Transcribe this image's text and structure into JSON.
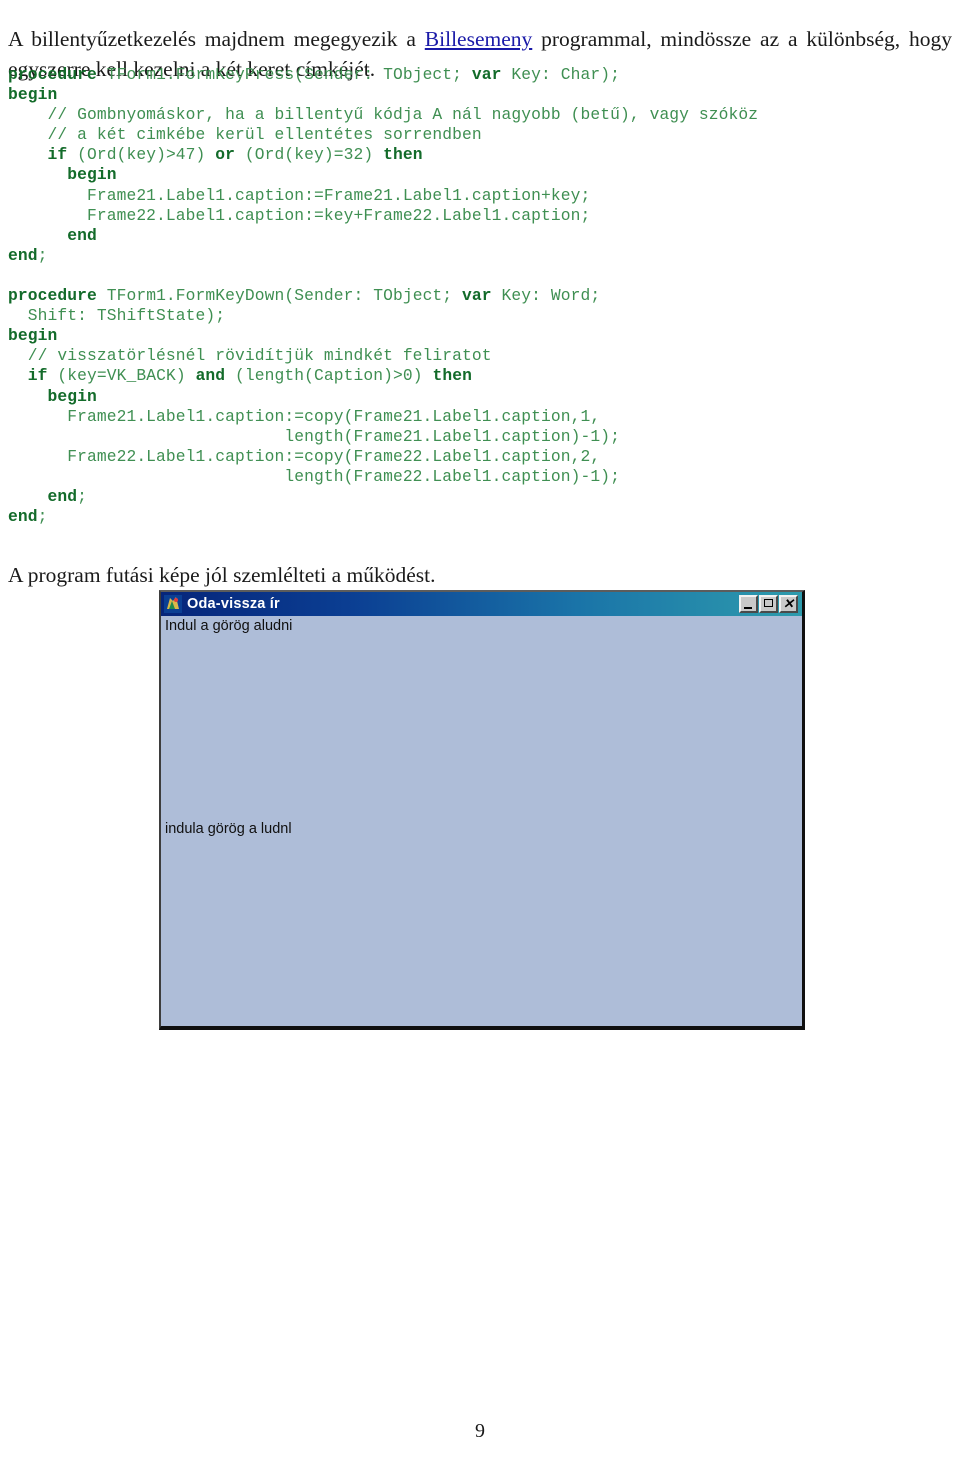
{
  "intro": {
    "before_link": "A billentyűzetkezelés majdnem megegyezik a ",
    "link_text": "Billesemeny",
    "after_link": " programmal, mindössze az a különbség, hogy egyszerre kell kezelni a két keret címkéjét."
  },
  "code": {
    "language": "Pascal/Delphi",
    "lines": [
      [
        {
          "t": "procedure",
          "s": "kw"
        },
        {
          "t": " TForm1.FormKeyPress(Sender: TObject; ",
          "s": "pl"
        },
        {
          "t": "var",
          "s": "kw"
        },
        {
          "t": " Key: Char);",
          "s": "pl"
        }
      ],
      [
        {
          "t": "begin",
          "s": "kw"
        }
      ],
      [
        {
          "t": "    // Gombnyomáskor, ha a billentyű kódja A nál nagyobb (betű), vagy szóköz",
          "s": "cm"
        }
      ],
      [
        {
          "t": "    // a két cimkébe kerül ellentétes sorrendben",
          "s": "cm"
        }
      ],
      [
        {
          "t": "    ",
          "s": "pl"
        },
        {
          "t": "if",
          "s": "kw"
        },
        {
          "t": " (Ord(key)>47) ",
          "s": "pl"
        },
        {
          "t": "or",
          "s": "kw"
        },
        {
          "t": " (Ord(key)=32) ",
          "s": "pl"
        },
        {
          "t": "then",
          "s": "kw"
        }
      ],
      [
        {
          "t": "      ",
          "s": "pl"
        },
        {
          "t": "begin",
          "s": "kw"
        }
      ],
      [
        {
          "t": "        Frame21.Label1.caption:=Frame21.Label1.caption+key;",
          "s": "pl"
        }
      ],
      [
        {
          "t": "        Frame22.Label1.caption:=key+Frame22.Label1.caption;",
          "s": "pl"
        }
      ],
      [
        {
          "t": "      ",
          "s": "pl"
        },
        {
          "t": "end",
          "s": "kw"
        }
      ],
      [
        {
          "t": "end",
          "s": "kw"
        },
        {
          "t": ";",
          "s": "pl"
        }
      ],
      [
        {
          "t": " ",
          "s": "pl"
        }
      ],
      [
        {
          "t": "procedure",
          "s": "kw"
        },
        {
          "t": " TForm1.FormKeyDown(Sender: TObject; ",
          "s": "pl"
        },
        {
          "t": "var",
          "s": "kw"
        },
        {
          "t": " Key: Word;",
          "s": "pl"
        }
      ],
      [
        {
          "t": "  Shift: TShiftState);",
          "s": "pl"
        }
      ],
      [
        {
          "t": "begin",
          "s": "kw"
        }
      ],
      [
        {
          "t": "  // visszatörlésnél rövidítjük mindkét feliratot",
          "s": "cm"
        }
      ],
      [
        {
          "t": "  ",
          "s": "pl"
        },
        {
          "t": "if",
          "s": "kw"
        },
        {
          "t": " (key=VK_BACK) ",
          "s": "pl"
        },
        {
          "t": "and",
          "s": "kw"
        },
        {
          "t": " (length(Caption)>0) ",
          "s": "pl"
        },
        {
          "t": "then",
          "s": "kw"
        }
      ],
      [
        {
          "t": "    ",
          "s": "pl"
        },
        {
          "t": "begin",
          "s": "kw"
        }
      ],
      [
        {
          "t": "      Frame21.Label1.caption:=copy(Frame21.Label1.caption,1,",
          "s": "pl"
        }
      ],
      [
        {
          "t": "                            length(Frame21.Label1.caption)-1);",
          "s": "pl"
        }
      ],
      [
        {
          "t": "      Frame22.Label1.caption:=copy(Frame22.Label1.caption,2,",
          "s": "pl"
        }
      ],
      [
        {
          "t": "                            length(Frame22.Label1.caption)-1);",
          "s": "pl"
        }
      ],
      [
        {
          "t": "    ",
          "s": "pl"
        },
        {
          "t": "end",
          "s": "kw"
        },
        {
          "t": ";",
          "s": "pl"
        }
      ],
      [
        {
          "t": "end",
          "s": "kw"
        },
        {
          "t": ";",
          "s": "pl"
        }
      ]
    ]
  },
  "caption": {
    "text": "A program futási képe jól szemlélteti a működést."
  },
  "app_window": {
    "title": "Oda-vissza ír",
    "icon": "delphi-app-icon",
    "buttons": {
      "minimize": "minimize-button",
      "maximize": "maximize-button",
      "close": "close-button"
    },
    "label_frame21": "Indul a görög aludni",
    "label_frame22": "indula görög a ludnl",
    "colors": {
      "titlebar_start": "#06257a",
      "titlebar_end": "#2e9bad",
      "client_background": "#aebdd8"
    }
  },
  "footer": {
    "page_number": "9"
  }
}
